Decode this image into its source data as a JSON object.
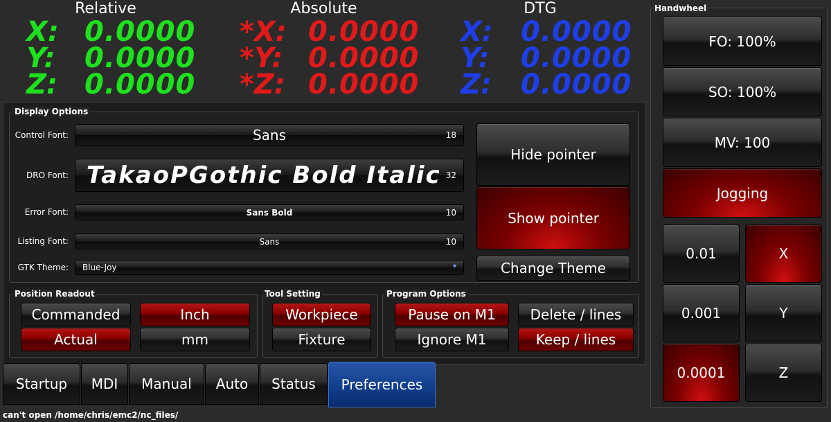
{
  "dro": {
    "relative": {
      "title": "Relative",
      "x_label": "X:",
      "y_label": "Y:",
      "z_label": "Z:",
      "x": "0.0000",
      "y": "0.0000",
      "z": "0.0000",
      "color": "#1ee01e"
    },
    "absolute": {
      "title": "Absolute",
      "x_label": "*X:",
      "y_label": "*Y:",
      "z_label": "*Z:",
      "x": "0.0000",
      "y": "0.0000",
      "z": "0.0000",
      "color": "#e01a1a"
    },
    "dtg": {
      "title": "DTG",
      "x_label": "X:",
      "y_label": "Y:",
      "z_label": "Z:",
      "x": "0.0000",
      "y": "0.0000",
      "z": "0.0000",
      "color": "#1e3ee8"
    }
  },
  "display_options": {
    "title": "Display Options",
    "control_font": {
      "label": "Control Font:",
      "value": "Sans",
      "size": "18"
    },
    "dro_font": {
      "label": "DRO Font:",
      "value": "TakaoPGothic Bold Italic",
      "size": "32"
    },
    "error_font": {
      "label": "Error Font:",
      "value": "Sans Bold",
      "size": "10"
    },
    "listing_font": {
      "label": "Listing Font:",
      "value": "Sans",
      "size": "10"
    },
    "gtk_theme": {
      "label": "GTK Theme:",
      "value": "Blue-Joy"
    },
    "hide_pointer": "Hide pointer",
    "show_pointer": "Show pointer",
    "change_theme": "Change Theme"
  },
  "position_readout": {
    "title": "Position Readout",
    "commanded": "Commanded",
    "actual": "Actual",
    "inch": "Inch",
    "mm": "mm"
  },
  "tool_setting": {
    "title": "Tool Setting",
    "workpiece": "Workpiece",
    "fixture": "Fixture"
  },
  "program_options": {
    "title": "Program Options",
    "pause_m1": "Pause on M1",
    "ignore_m1": "Ignore M1",
    "delete_lines": "Delete / lines",
    "keep_lines": "Keep / lines"
  },
  "tabs": [
    "Startup",
    "MDI",
    "Manual",
    "Auto",
    "Status",
    "Preferences"
  ],
  "handwheel": {
    "title": "Handwheel",
    "fo": "FO: 100%",
    "so": "SO: 100%",
    "mv": "MV: 100",
    "jogging": "Jogging",
    "inc1": "0.01",
    "inc2": "0.001",
    "inc3": "0.0001",
    "axis_x": "X",
    "axis_y": "Y",
    "axis_z": "Z"
  },
  "status_bar": "can't open /home/chris/emc2/nc_files/"
}
